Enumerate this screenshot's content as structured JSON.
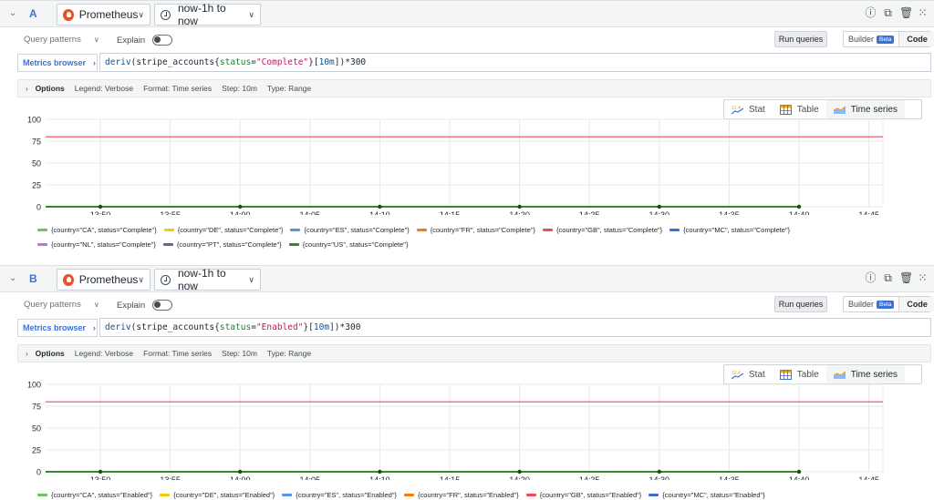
{
  "queries": [
    {
      "ref_id": "A",
      "datasource": "Prometheus",
      "time_range": "now-1h to now",
      "query_patterns_label": "Query patterns",
      "explain_label": "Explain",
      "run_label": "Run queries",
      "builder_label": "Builder",
      "beta_label": "Beta",
      "code_label": "Code",
      "metrics_browser_label": "Metrics browser",
      "expr": {
        "fn": "deriv",
        "metric": "stripe_accounts",
        "label": "status",
        "value": "\"Complete\"",
        "range": "10m",
        "suffix": "*300"
      },
      "options": {
        "title": "Options",
        "legend": "Legend: Verbose",
        "format": "Format: Time series",
        "step": "Step: 10m",
        "type": "Type: Range"
      },
      "views": [
        "Stat",
        "Table",
        "Time series"
      ],
      "active_view": "Time series",
      "chart_data": {
        "type": "line",
        "x": [
          "13:50",
          "13:55",
          "14:00",
          "14:05",
          "14:10",
          "14:15",
          "14:20",
          "14:25",
          "14:30",
          "14:35",
          "14:40",
          "14:45"
        ],
        "y_ticks": [
          100,
          75,
          50,
          25,
          0
        ],
        "ylim": [
          0,
          100
        ],
        "series_values_at_points": [
          "13:50",
          "14:00",
          "14:10",
          "14:20",
          "14:30",
          "14:40"
        ],
        "flat_line_value": 80,
        "flat_line_color": "#f2495c",
        "series": [
          {
            "name": "{country=\"CA\", status=\"Complete\"}",
            "color": "#73bf69",
            "value": 0
          },
          {
            "name": "{country=\"DE\", status=\"Complete\"}",
            "color": "#f2cc0c",
            "value": 0
          },
          {
            "name": "{country=\"ES\", status=\"Complete\"}",
            "color": "#5794f2",
            "value": 0
          },
          {
            "name": "{country=\"FR\", status=\"Complete\"}",
            "color": "#ff780a",
            "value": 0
          },
          {
            "name": "{country=\"GB\", status=\"Complete\"}",
            "color": "#f2495c",
            "value": 80
          },
          {
            "name": "{country=\"MC\", status=\"Complete\"}",
            "color": "#3274d9",
            "value": 0
          },
          {
            "name": "{country=\"NL\", status=\"Complete\"}",
            "color": "#b877d9",
            "value": 0
          },
          {
            "name": "{country=\"PT\", status=\"Complete\"}",
            "color": "#705da0",
            "value": 0
          },
          {
            "name": "{country=\"US\", status=\"Complete\"}",
            "color": "#37872d",
            "value": 0
          }
        ]
      }
    },
    {
      "ref_id": "B",
      "datasource": "Prometheus",
      "time_range": "now-1h to now",
      "query_patterns_label": "Query patterns",
      "explain_label": "Explain",
      "run_label": "Run queries",
      "builder_label": "Builder",
      "beta_label": "Beta",
      "code_label": "Code",
      "metrics_browser_label": "Metrics browser",
      "expr": {
        "fn": "deriv",
        "metric": "stripe_accounts",
        "label": "status",
        "value": "\"Enabled\"",
        "range": "10m",
        "suffix": "*300"
      },
      "options": {
        "title": "Options",
        "legend": "Legend: Verbose",
        "format": "Format: Time series",
        "step": "Step: 10m",
        "type": "Type: Range"
      },
      "views": [
        "Stat",
        "Table",
        "Time series"
      ],
      "active_view": "Time series",
      "chart_data": {
        "type": "line",
        "x": [
          "13:50",
          "13:55",
          "14:00",
          "14:05",
          "14:10",
          "14:15",
          "14:20",
          "14:25",
          "14:30",
          "14:35",
          "14:40",
          "14:45"
        ],
        "y_ticks": [
          100,
          75,
          50,
          25,
          0
        ],
        "ylim": [
          0,
          100
        ],
        "series_values_at_points": [
          "13:50",
          "14:00",
          "14:10",
          "14:20",
          "14:30",
          "14:40"
        ],
        "flat_line_value": 80,
        "flat_line_color": "#f2495c",
        "series": [
          {
            "name": "{country=\"CA\", status=\"Enabled\"}",
            "color": "#73bf69",
            "value": 0
          },
          {
            "name": "{country=\"DE\", status=\"Enabled\"}",
            "color": "#f2cc0c",
            "value": 0
          },
          {
            "name": "{country=\"ES\", status=\"Enabled\"}",
            "color": "#5794f2",
            "value": 0
          },
          {
            "name": "{country=\"FR\", status=\"Enabled\"}",
            "color": "#ff780a",
            "value": 0
          },
          {
            "name": "{country=\"GB\", status=\"Enabled\"}",
            "color": "#f2495c",
            "value": 80
          },
          {
            "name": "{country=\"MC\", status=\"Enabled\"}",
            "color": "#3274d9",
            "value": 0
          }
        ]
      }
    }
  ]
}
